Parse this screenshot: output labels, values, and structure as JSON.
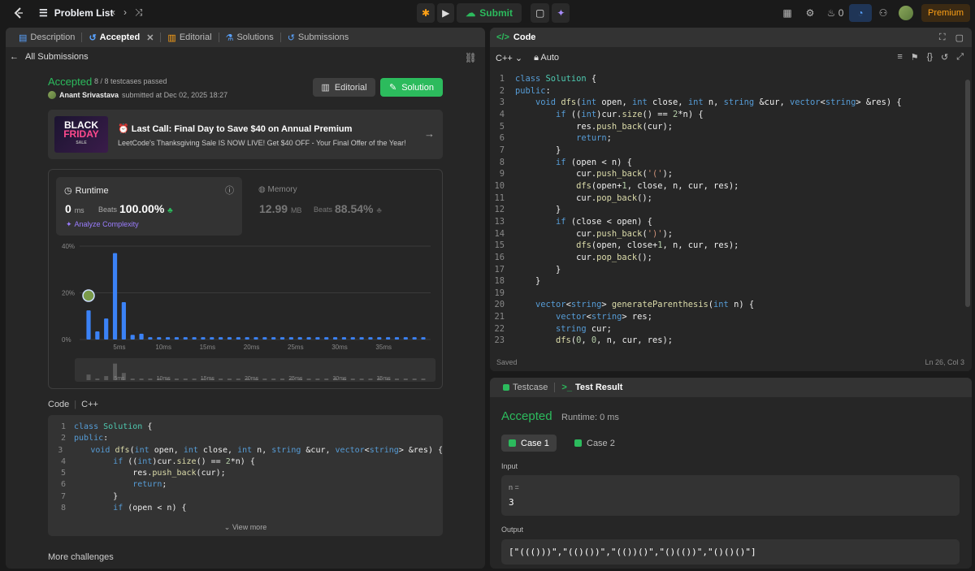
{
  "topbar": {
    "problem_list": "Problem List",
    "submit": "Submit",
    "streak": "0",
    "premium": "Premium"
  },
  "left": {
    "tabs": [
      "Description",
      "Accepted",
      "Editorial",
      "Solutions",
      "Submissions"
    ],
    "all_submissions": "All Submissions",
    "status": "Accepted",
    "passed": "8 / 8 testcases passed",
    "author": "Anant Srivastava",
    "submitted": "submitted at Dec 02, 2025 18:27",
    "editorial_btn": "Editorial",
    "solution_btn": "Solution",
    "banner": {
      "title": "Last Call: Final Day to Save $40 on Annual Premium",
      "subtitle": "LeetCode's Thanksgiving Sale IS NOW LIVE! Get $40 OFF - Your Final Offer of the Year!",
      "img_line1": "BLACK",
      "img_line2": "FRIDAY",
      "img_line3": "SALE"
    },
    "runtime": {
      "label": "Runtime",
      "value": "0",
      "unit": "ms",
      "beats_label": "Beats",
      "beats": "100.00%",
      "analyze": "Analyze Complexity"
    },
    "memory": {
      "label": "Memory",
      "value": "12.99",
      "unit": "MB",
      "beats_label": "Beats",
      "beats": "88.54%"
    },
    "code_label": "Code",
    "code_lang": "C++",
    "view_more": "View more",
    "more_challenges": "More challenges"
  },
  "chart_data": {
    "type": "bar",
    "title": "",
    "xlabel": "Runtime (ms)",
    "ylabel": "",
    "ylim": [
      0,
      40
    ],
    "yticks": [
      "40%",
      "20%",
      "0%"
    ],
    "xticks": [
      "5ms",
      "10ms",
      "15ms",
      "20ms",
      "25ms",
      "30ms",
      "35ms"
    ],
    "x": [
      0,
      1,
      2,
      3,
      4,
      5,
      6,
      7,
      8,
      9,
      10,
      11,
      12,
      13,
      14,
      15,
      16,
      17,
      18,
      19,
      20,
      21,
      22,
      23,
      24,
      25,
      26,
      27,
      28,
      29,
      30,
      31,
      32,
      33,
      34,
      35,
      36,
      37,
      38
    ],
    "values": [
      12.5,
      3.5,
      9,
      37,
      16,
      2,
      2.5,
      1,
      1,
      1,
      1,
      1,
      1,
      1,
      1,
      1,
      1,
      1,
      1,
      1,
      1,
      1,
      1,
      1,
      1,
      1,
      1,
      1,
      1,
      1,
      1,
      1,
      1,
      1,
      1,
      1,
      1,
      1,
      1
    ],
    "user_bin": 0,
    "bar_color": "#3b82f6",
    "grid": true
  },
  "code": {
    "header": "Code",
    "lang": "C++",
    "mode": "Auto",
    "saved": "Saved",
    "position": "Ln 26, Col 3",
    "lines": [
      "class Solution {",
      "public:",
      "    void dfs(int open, int close, int n, string &cur, vector<string> &res) {",
      "        if ((int)cur.size() == 2*n) {",
      "            res.push_back(cur);",
      "            return;",
      "        }",
      "        if (open < n) {",
      "            cur.push_back('(');",
      "            dfs(open+1, close, n, cur, res);",
      "            cur.pop_back();",
      "        }",
      "        if (close < open) {",
      "            cur.push_back(')');",
      "            dfs(open, close+1, n, cur, res);",
      "            cur.pop_back();",
      "        }",
      "    }",
      "",
      "    vector<string> generateParenthesis(int n) {",
      "        vector<string> res;",
      "        string cur;",
      "        dfs(0, 0, n, cur, res);"
    ]
  },
  "test": {
    "tab_testcase": "Testcase",
    "tab_result": "Test Result",
    "status": "Accepted",
    "runtime": "Runtime: 0 ms",
    "case1": "Case 1",
    "case2": "Case 2",
    "input_label": "Input",
    "input_var": "n =",
    "input_value": "3",
    "output_label": "Output",
    "output_value": "[\"((()))\",\"(()())\",\"(())()\",\"()(())\",\"()()()\"]"
  }
}
